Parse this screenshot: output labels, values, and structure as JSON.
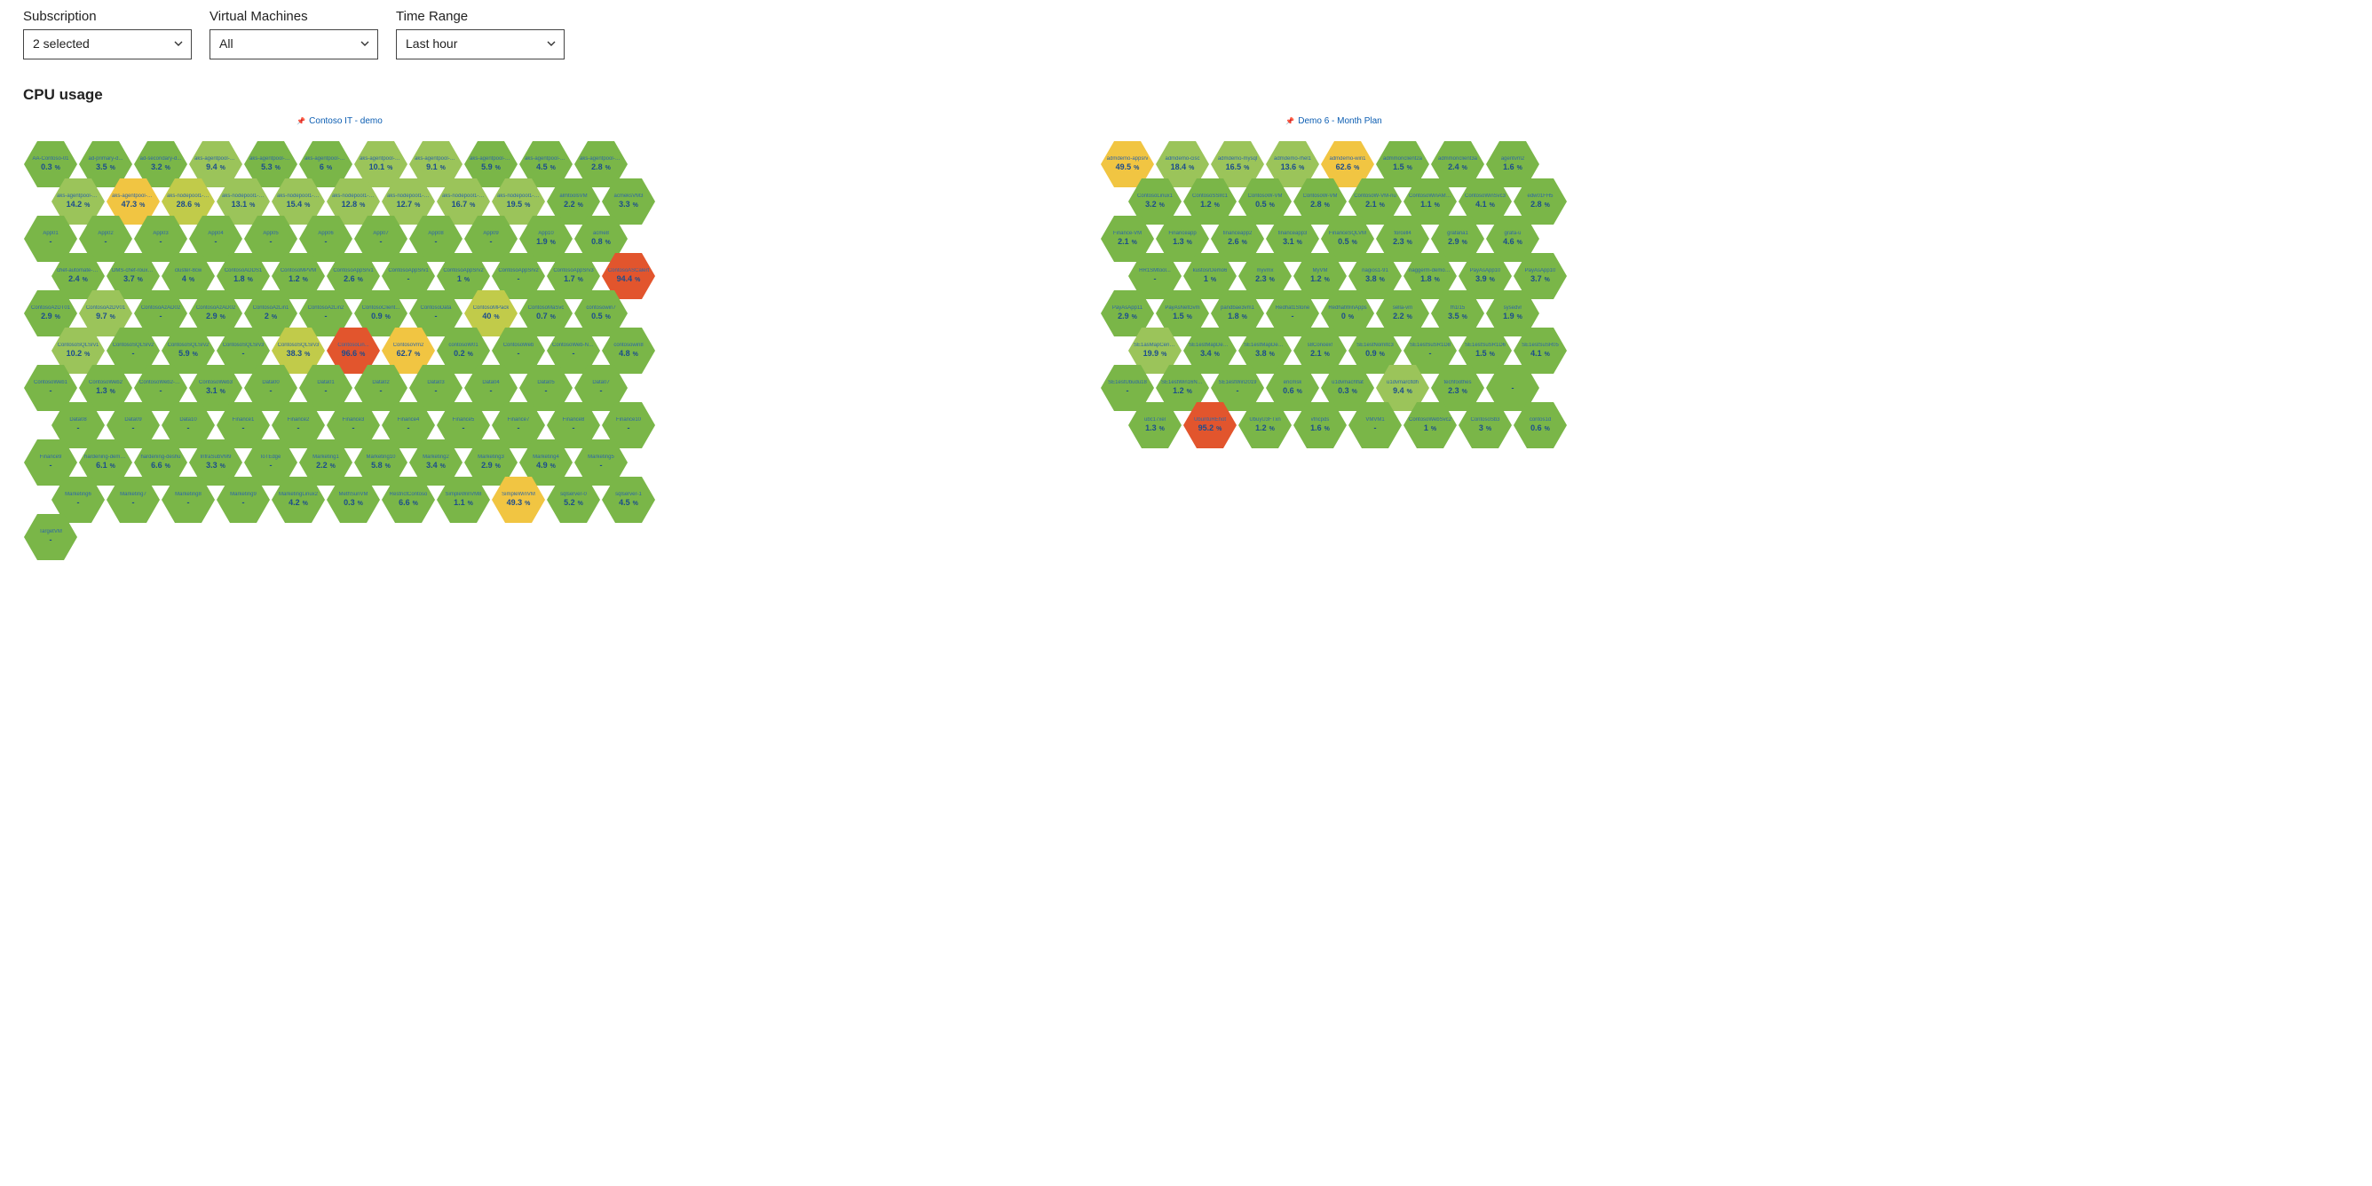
{
  "filters": {
    "subscription": {
      "label": "Subscription",
      "value": "2 selected"
    },
    "vms": {
      "label": "Virtual Machines",
      "value": "All"
    },
    "time": {
      "label": "Time Range",
      "value": "Last hour"
    }
  },
  "section_title": "CPU usage",
  "colors": {
    "green": "#7ab648",
    "green_dark": "#6aa83d",
    "lightgreen": "#9bc45a",
    "yellowgreen": "#c1cb4a",
    "yellow": "#f1c542",
    "orange": "#e27a36",
    "red": "#e2552d"
  },
  "chart_data": [
    {
      "title": "Contoso IT - demo",
      "type": "heatmap",
      "unit": "%",
      "rows": [
        [
          {
            "n": "AA-Contoso-01",
            "v": 0.3,
            "c": "green"
          },
          {
            "n": "ad-primary-d...",
            "v": 3.5,
            "c": "green"
          },
          {
            "n": "ad-secondary-d...",
            "v": 3.2,
            "c": "green"
          },
          {
            "n": "aks-agentpool-40719",
            "v": 9.4,
            "c": "lightgreen"
          },
          {
            "n": "aks-agentpool-14157",
            "v": 5.3,
            "c": "green"
          },
          {
            "n": "aks-agentpool-14157",
            "v": 6,
            "c": "green"
          },
          {
            "n": "aks-agentpool-14820",
            "v": 10.1,
            "c": "lightgreen"
          },
          {
            "n": "aks-agentpool-18840",
            "v": 9.1,
            "c": "lightgreen"
          },
          {
            "n": "aks-agentpool-18840",
            "v": 5.9,
            "c": "green"
          },
          {
            "n": "aks-agentpool-40718",
            "v": 4.5,
            "c": "green"
          },
          {
            "n": "aks-agentpool-40718",
            "v": 2.8,
            "c": "green"
          }
        ],
        [
          {
            "n": "aks-agentpool-40719",
            "v": 14.2,
            "c": "lightgreen"
          },
          {
            "n": "aks-agentpool-40719",
            "v": 47.3,
            "c": "yellow"
          },
          {
            "n": "aks-nodepool1-2549...",
            "v": 28.6,
            "c": "yellowgreen"
          },
          {
            "n": "aks-nodepool1-4281",
            "v": 13.1,
            "c": "lightgreen"
          },
          {
            "n": "aks-nodepool1-4281",
            "v": 15.4,
            "c": "lightgreen"
          },
          {
            "n": "aks-nodepool1-8538",
            "v": 12.8,
            "c": "lightgreen"
          },
          {
            "n": "aks-nodepool1-8538",
            "v": 12.7,
            "c": "lightgreen"
          },
          {
            "n": "aks-nodepool1-9520",
            "v": 16.7,
            "c": "lightgreen"
          },
          {
            "n": "aks-nodepool1-9520",
            "v": 19.5,
            "c": "lightgreen"
          },
          {
            "n": "almtoolsVM",
            "v": 2.2,
            "c": "green"
          },
          {
            "n": "acmeksVM3",
            "v": 3.3,
            "c": "green"
          }
        ],
        [
          {
            "n": "App01",
            "v": null,
            "c": "green"
          },
          {
            "n": "App02",
            "v": null,
            "c": "green"
          },
          {
            "n": "App03",
            "v": null,
            "c": "green"
          },
          {
            "n": "App04",
            "v": null,
            "c": "green"
          },
          {
            "n": "App05",
            "v": null,
            "c": "green"
          },
          {
            "n": "App06",
            "v": null,
            "c": "green"
          },
          {
            "n": "App07",
            "v": null,
            "c": "green"
          },
          {
            "n": "App08",
            "v": null,
            "c": "green"
          },
          {
            "n": "App09",
            "v": null,
            "c": "green"
          },
          {
            "n": "App10",
            "v": 1.9,
            "c": "green"
          },
          {
            "n": "acme8",
            "v": 0.8,
            "c": "green"
          }
        ],
        [
          {
            "n": "chef-automate-vsco",
            "v": 2.4,
            "c": "green"
          },
          {
            "n": "DMS-chef-roux-VM",
            "v": 3.7,
            "c": "green"
          },
          {
            "n": "cluster-8cw",
            "v": 4,
            "c": "green"
          },
          {
            "n": "ContosoADDS1",
            "v": 1.8,
            "c": "green"
          },
          {
            "n": "ContosoMPVM",
            "v": 1.2,
            "c": "green"
          },
          {
            "n": "ContosoAppSrv1",
            "v": 2.6,
            "c": "green"
          },
          {
            "n": "ContosoAppSrv1",
            "v": null,
            "c": "green"
          },
          {
            "n": "ContosoAppSrv2",
            "v": 1,
            "c": "green"
          },
          {
            "n": "ContosoAppSrv2",
            "v": null,
            "c": "green"
          },
          {
            "n": "ContosoAppSrv3",
            "v": 1.7,
            "c": "green"
          },
          {
            "n": "ContosoASCalert",
            "v": 94.4,
            "c": "red"
          }
        ],
        [
          {
            "n": "ContosoAzDT01",
            "v": 2.9,
            "c": "green"
          },
          {
            "n": "ContosoAzDV01",
            "v": 9.7,
            "c": "lightgreen"
          },
          {
            "n": "ContosoAzAD02",
            "v": null,
            "c": "green"
          },
          {
            "n": "ContosoAzAD02",
            "v": 2.9,
            "c": "green"
          },
          {
            "n": "ContosoAzLin1",
            "v": 2,
            "c": "green"
          },
          {
            "n": "ContosoAzLin2",
            "v": null,
            "c": "green"
          },
          {
            "n": "ContosoClient...",
            "v": 0.9,
            "c": "green"
          },
          {
            "n": "ContosoData",
            "v": null,
            "c": "green"
          },
          {
            "n": "ContosoMPack",
            "v": 40,
            "c": "yellowgreen"
          },
          {
            "n": "ContosoMaSvc",
            "v": 0.7,
            "c": "green"
          },
          {
            "n": "contosowin7",
            "v": 0.5,
            "c": "green"
          }
        ],
        [
          {
            "n": "ContosoSQLSrv1",
            "v": 10.2,
            "c": "lightgreen"
          },
          {
            "n": "ContosoSQLSrv2",
            "v": null,
            "c": "green"
          },
          {
            "n": "ContosoSQLSrv2",
            "v": 5.9,
            "c": "green"
          },
          {
            "n": "ContosoSQLSrv3",
            "v": null,
            "c": "green"
          },
          {
            "n": "ContosoSQLSrv3",
            "v": 38.3,
            "c": "yellowgreen"
          },
          {
            "n": "ContosoLin...",
            "v": 96.6,
            "c": "red"
          },
          {
            "n": "ContosoVm2",
            "v": 62.7,
            "c": "yellow"
          },
          {
            "n": "contosoW01",
            "v": 0.2,
            "c": "green"
          },
          {
            "n": "ContosoWeb",
            "v": null,
            "c": "green"
          },
          {
            "n": "ContosoWeb-NoSvc",
            "v": null,
            "c": "green"
          },
          {
            "n": "contosowin8",
            "v": 4.8,
            "c": "green"
          }
        ],
        [
          {
            "n": "ContosoWeb1",
            "v": null,
            "c": "green"
          },
          {
            "n": "ContosoWeb2",
            "v": 1.3,
            "c": "green"
          },
          {
            "n": "ContosoWeb2-Linux",
            "v": null,
            "c": "green"
          },
          {
            "n": "ContosoWeb3",
            "v": 3.1,
            "c": "green"
          },
          {
            "n": "Data00",
            "v": null,
            "c": "green"
          },
          {
            "n": "Data01",
            "v": null,
            "c": "green"
          },
          {
            "n": "Data02",
            "v": null,
            "c": "green"
          },
          {
            "n": "Data03",
            "v": null,
            "c": "green"
          },
          {
            "n": "Data04",
            "v": null,
            "c": "green"
          },
          {
            "n": "Data05",
            "v": null,
            "c": "green"
          },
          {
            "n": "Data07",
            "v": null,
            "c": "green"
          }
        ],
        [
          {
            "n": "Data08",
            "v": null,
            "c": "green"
          },
          {
            "n": "Data09",
            "v": null,
            "c": "green"
          },
          {
            "n": "Data10",
            "v": null,
            "c": "green"
          },
          {
            "n": "Finance1",
            "v": null,
            "c": "green"
          },
          {
            "n": "Finance2",
            "v": null,
            "c": "green"
          },
          {
            "n": "Finance3",
            "v": null,
            "c": "green"
          },
          {
            "n": "Finance4",
            "v": null,
            "c": "green"
          },
          {
            "n": "Finance5",
            "v": null,
            "c": "green"
          },
          {
            "n": "Finance7",
            "v": null,
            "c": "green"
          },
          {
            "n": "Finance8",
            "v": null,
            "c": "green"
          },
          {
            "n": "Finance10",
            "v": null,
            "c": "green"
          }
        ],
        [
          {
            "n": "Finance9",
            "v": null,
            "c": "green"
          },
          {
            "n": "hardening-demo...",
            "v": 6.1,
            "c": "green"
          },
          {
            "n": "hardening-deshu",
            "v": 6.6,
            "c": "green"
          },
          {
            "n": "InfraSubVM9",
            "v": 3.3,
            "c": "green"
          },
          {
            "n": "IoTEdge",
            "v": null,
            "c": "green"
          },
          {
            "n": "Marketing1",
            "v": 2.2,
            "c": "green"
          },
          {
            "n": "Marketing10",
            "v": 5.8,
            "c": "green"
          },
          {
            "n": "Marketing2",
            "v": 3.4,
            "c": "green"
          },
          {
            "n": "Marketing3",
            "v": 2.9,
            "c": "green"
          },
          {
            "n": "Marketing4",
            "v": 4.9,
            "c": "green"
          },
          {
            "n": "Marketing5",
            "v": null,
            "c": "green"
          }
        ],
        [
          {
            "n": "Marketing6",
            "v": null,
            "c": "green"
          },
          {
            "n": "Marketing7",
            "v": null,
            "c": "green"
          },
          {
            "n": "Marketing8",
            "v": null,
            "c": "green"
          },
          {
            "n": "Marketing9",
            "v": null,
            "c": "green"
          },
          {
            "n": "MarketingLinux2",
            "v": 4.2,
            "c": "green"
          },
          {
            "n": "MethSunVM",
            "v": 0.3,
            "c": "green"
          },
          {
            "n": "RestrictContoso",
            "v": 6.6,
            "c": "green"
          },
          {
            "n": "SimpleWinVM8",
            "v": 1.1,
            "c": "green"
          },
          {
            "n": "SimpleWinVM",
            "v": 49.3,
            "c": "yellow"
          },
          {
            "n": "sqlserver-0",
            "v": 5.2,
            "c": "green"
          },
          {
            "n": "sqlserver-1",
            "v": 4.5,
            "c": "green"
          }
        ],
        [
          {
            "n": "TargetVM",
            "v": null,
            "c": "green"
          }
        ]
      ]
    },
    {
      "title": "Demo 6 - Month Plan",
      "type": "heatmap",
      "unit": "%",
      "rows": [
        [
          {
            "n": "admdemo-appsrv",
            "v": 49.5,
            "c": "yellow"
          },
          {
            "n": "admdemo-cisc",
            "v": 18.4,
            "c": "lightgreen"
          },
          {
            "n": "admdemo-mysql",
            "v": 16.5,
            "c": "lightgreen"
          },
          {
            "n": "admdemo-rhel1",
            "v": 13.6,
            "c": "lightgreen"
          },
          {
            "n": "admdemo-win1",
            "v": 62.6,
            "c": "yellow"
          },
          {
            "n": "admmonclient2a",
            "v": 1.5,
            "c": "green"
          },
          {
            "n": "admmonclient3a",
            "v": 2.4,
            "c": "green"
          },
          {
            "n": "agentvm2",
            "v": 1.6,
            "c": "green"
          }
        ],
        [
          {
            "n": "ContosoLinux1",
            "v": 3.2,
            "c": "green"
          },
          {
            "n": "ContosoSSlrc1",
            "v": 1.2,
            "c": "green"
          },
          {
            "n": "ContosoW-VM",
            "v": 0.5,
            "c": "green"
          },
          {
            "n": "ContosoW-VM",
            "v": 2.8,
            "c": "green"
          },
          {
            "n": "ContosoW-VM-nu",
            "v": 2.1,
            "c": "green"
          },
          {
            "n": "ContosoWinAMan",
            "v": 1.1,
            "c": "green"
          },
          {
            "n": "ContosoWinSvc3",
            "v": 4.1,
            "c": "green"
          },
          {
            "n": "edw01FH5",
            "v": 2.8,
            "c": "green"
          }
        ],
        [
          {
            "n": "Finance-VM",
            "v": 2.1,
            "c": "green"
          },
          {
            "n": "Financeapp",
            "v": 1.3,
            "c": "green"
          },
          {
            "n": "financeapp2",
            "v": 2.6,
            "c": "green"
          },
          {
            "n": "financeapp3",
            "v": 3.1,
            "c": "green"
          },
          {
            "n": "FinanceSQLVM",
            "v": 0.5,
            "c": "green"
          },
          {
            "n": "forcell4",
            "v": 2.3,
            "c": "green"
          },
          {
            "n": "grafana1",
            "v": 2.9,
            "c": "green"
          },
          {
            "n": "grafa-u",
            "v": 4.6,
            "c": "green"
          }
        ],
        [
          {
            "n": "HR1SMtool...",
            "v": null,
            "c": "green"
          },
          {
            "n": "kustosrDemo6",
            "v": 1,
            "c": "green"
          },
          {
            "n": "myvmx",
            "v": 2.3,
            "c": "green"
          },
          {
            "n": "MyVM",
            "v": 1.2,
            "c": "green"
          },
          {
            "n": "nagios1-91",
            "v": 3.8,
            "c": "green"
          },
          {
            "n": "naggerm-demo-81",
            "v": 1.8,
            "c": "green"
          },
          {
            "n": "PayAsApp10",
            "v": 3.9,
            "c": "green"
          },
          {
            "n": "PayAsApp10",
            "v": 3.7,
            "c": "green"
          }
        ],
        [
          {
            "n": "PayAsApp11",
            "v": 2.9,
            "c": "green"
          },
          {
            "n": "PayAsNetGvm",
            "v": 1.5,
            "c": "green"
          },
          {
            "n": "pandbae3vm1",
            "v": 1.8,
            "c": "green"
          },
          {
            "n": "Redhat1Stone",
            "v": null,
            "c": "green"
          },
          {
            "n": "RedhatWinApps",
            "v": 0,
            "c": "green"
          },
          {
            "n": "sella-vm",
            "v": 2.2,
            "c": "green"
          },
          {
            "n": "fh1l15",
            "v": 3.5,
            "c": "green"
          },
          {
            "n": "sysedvr",
            "v": 1.9,
            "c": "green"
          }
        ],
        [
          {
            "n": "SE1asMapCentos72",
            "v": 19.9,
            "c": "lightgreen"
          },
          {
            "n": "SE1estMapDebian78",
            "v": 3.4,
            "c": "green"
          },
          {
            "n": "SE1estMapDebian78",
            "v": 3.8,
            "c": "green"
          },
          {
            "n": "s8Conoex!",
            "v": 2.1,
            "c": "green"
          },
          {
            "n": "SE1estNomItc3",
            "v": 0.9,
            "c": "green"
          },
          {
            "n": "SE1estSuSR1D8",
            "v": null,
            "c": "green"
          },
          {
            "n": "SE1estSuSR1D6",
            "v": 1.5,
            "c": "green"
          },
          {
            "n": "SE1estSuSR05",
            "v": 4.1,
            "c": "green"
          }
        ],
        [
          {
            "n": "SE1estUbudu18",
            "v": null,
            "c": "green"
          },
          {
            "n": "SE1estWin16NBS",
            "v": 1.2,
            "c": "green"
          },
          {
            "n": "SE1estWin2019",
            "v": null,
            "c": "green"
          },
          {
            "n": "ericmsk",
            "v": 0.6,
            "c": "green"
          },
          {
            "n": "u1dvmachflat",
            "v": 0.3,
            "c": "green"
          },
          {
            "n": "u1dvmarcltdh",
            "v": 9.4,
            "c": "lightgreen"
          },
          {
            "n": "techfoothes",
            "v": 2.3,
            "c": "green"
          },
          {
            "n": "",
            "v": null,
            "c": "green"
          }
        ],
        [
          {
            "n": "ubc17xel",
            "v": 1.3,
            "c": "green"
          },
          {
            "n": "UbuntuREhot",
            "v": 95.2,
            "c": "red"
          },
          {
            "n": "UbuyU3FTxn",
            "v": 1.2,
            "c": "green"
          },
          {
            "n": "vfncpds",
            "v": 1.6,
            "c": "green"
          },
          {
            "n": "VMVM1",
            "v": null,
            "c": "green"
          },
          {
            "n": "ContosoWebSvc2",
            "v": 1,
            "c": "green"
          },
          {
            "n": "ContosoSb3",
            "v": 3,
            "c": "green"
          },
          {
            "n": "contos1d",
            "v": 0.6,
            "c": "green"
          }
        ]
      ]
    }
  ]
}
